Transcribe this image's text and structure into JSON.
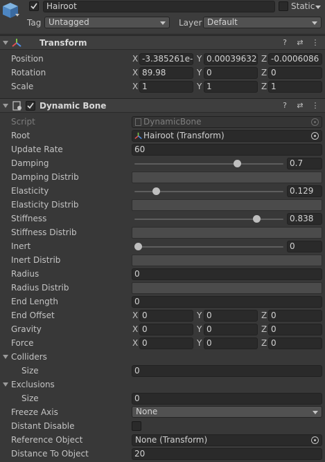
{
  "header": {
    "object_name": "Hairoot",
    "static_label": "Static",
    "tag_label": "Tag",
    "tag_value": "Untagged",
    "layer_label": "Layer",
    "layer_value": "Default"
  },
  "transform": {
    "title": "Transform",
    "rows": [
      {
        "label": "Position",
        "x": "-3.385261e-",
        "y": "0.00039632",
        "z": "-0.0006086"
      },
      {
        "label": "Rotation",
        "x": "89.98",
        "y": "0",
        "z": "0"
      },
      {
        "label": "Scale",
        "x": "1",
        "y": "1",
        "z": "1"
      }
    ],
    "axis_x": "X",
    "axis_y": "Y",
    "axis_z": "Z"
  },
  "dynamic_bone": {
    "title": "Dynamic Bone",
    "script_label": "Script",
    "script_value": "DynamicBone",
    "root_label": "Root",
    "root_value": "Hairoot (Transform)",
    "update_rate_label": "Update Rate",
    "update_rate_value": "60",
    "damping_label": "Damping",
    "damping_value": "0.7",
    "damping_level": 0.7,
    "damping_distrib_label": "Damping Distrib",
    "elasticity_label": "Elasticity",
    "elasticity_value": "0.129",
    "elasticity_level": 0.129,
    "elasticity_distrib_label": "Elasticity Distrib",
    "stiffness_label": "Stiffness",
    "stiffness_value": "0.838",
    "stiffness_level": 0.838,
    "stiffness_distrib_label": "Stiffness Distrib",
    "inert_label": "Inert",
    "inert_value": "0",
    "inert_level": 0,
    "inert_distrib_label": "Inert Distrib",
    "radius_label": "Radius",
    "radius_value": "0",
    "radius_distrib_label": "Radius Distrib",
    "end_length_label": "End Length",
    "end_length_value": "0",
    "end_offset": {
      "label": "End Offset",
      "x": "0",
      "y": "0",
      "z": "0"
    },
    "gravity": {
      "label": "Gravity",
      "x": "0",
      "y": "0",
      "z": "0"
    },
    "force": {
      "label": "Force",
      "x": "0",
      "y": "0",
      "z": "0"
    },
    "colliders_label": "Colliders",
    "colliders_size_label": "Size",
    "colliders_size_value": "0",
    "exclusions_label": "Exclusions",
    "exclusions_size_label": "Size",
    "exclusions_size_value": "0",
    "freeze_axis_label": "Freeze Axis",
    "freeze_axis_value": "None",
    "distant_disable_label": "Distant Disable",
    "reference_object_label": "Reference Object",
    "reference_object_value": "None (Transform)",
    "distance_to_object_label": "Distance To Object",
    "distance_to_object_value": "20"
  },
  "icons": {
    "help": "?",
    "presets": "⇄",
    "menu": "⋮"
  }
}
